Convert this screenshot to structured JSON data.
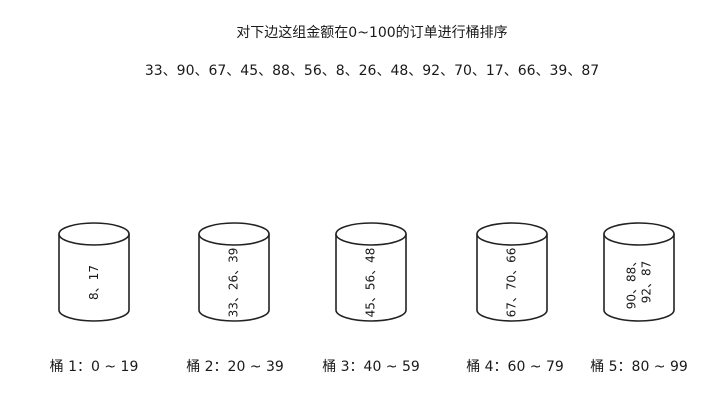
{
  "title": "对下边这组金额在0~100的订单进行桶排序",
  "sequence": "33、90、67、45、88、56、8、26、48、92、70、17、66、39、87",
  "buckets": [
    {
      "contents": [
        "8、17"
      ],
      "label": "桶 1：0 ~ 19"
    },
    {
      "contents": [
        "33、26、39"
      ],
      "label": "桶 2：20 ~ 39"
    },
    {
      "contents": [
        "45、56、48"
      ],
      "label": "桶 3：40 ~ 59"
    },
    {
      "contents": [
        "67、70、66"
      ],
      "label": "桶 4：60 ~ 79"
    },
    {
      "contents": [
        "90、88、",
        "92、87"
      ],
      "label": "桶 5：80 ~ 99"
    }
  ]
}
